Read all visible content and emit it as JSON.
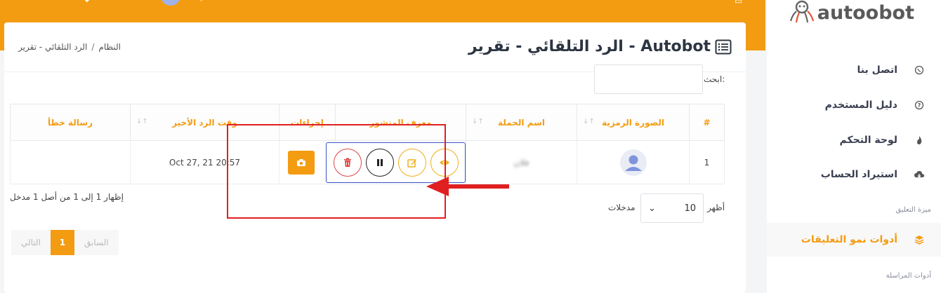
{
  "app": {
    "brand": "autoobot",
    "accent_color": "#f39c12"
  },
  "sidebar": {
    "items": [
      {
        "label": "اتصل بنا",
        "icon": "whatsapp-icon"
      },
      {
        "label": "دليل المستخدم",
        "icon": "help-circle-icon"
      },
      {
        "label": "لوحة التحكم",
        "icon": "flame-icon"
      },
      {
        "label": "استيراد الحساب",
        "icon": "cloud-download-icon"
      }
    ],
    "section_comments": "ميزة التعليق",
    "active_item": {
      "label": "أدوات نمو التعليقات",
      "icon": "layers-icon"
    },
    "section_messaging": "أدوات المراسلة"
  },
  "header": {
    "title": "Autobot - الرد التلقائي - تقرير",
    "breadcrumb": [
      "النظام",
      "الرد التلقائي - تقرير"
    ],
    "breadcrumb_sep": "/"
  },
  "search": {
    "label": "ابحث:"
  },
  "table": {
    "columns": [
      "#",
      "الصورة الرمزية",
      "اسم الحملة",
      "معرف المنشور",
      "إجراءات",
      "وقت الرد الأخير",
      "رسالة خطأ"
    ],
    "rows": [
      {
        "index": "1",
        "campaign": "فلان",
        "last_reply": "Oct 27, 21 20:57",
        "error": ""
      }
    ]
  },
  "footer": {
    "info": "إظهار 1 إلى 1 من أصل 1 مدخل",
    "show_label": "أظهر",
    "page_size": "10",
    "entries_label": "مدخلات",
    "prev": "السابق",
    "current_page": "1",
    "next": "التالي"
  }
}
